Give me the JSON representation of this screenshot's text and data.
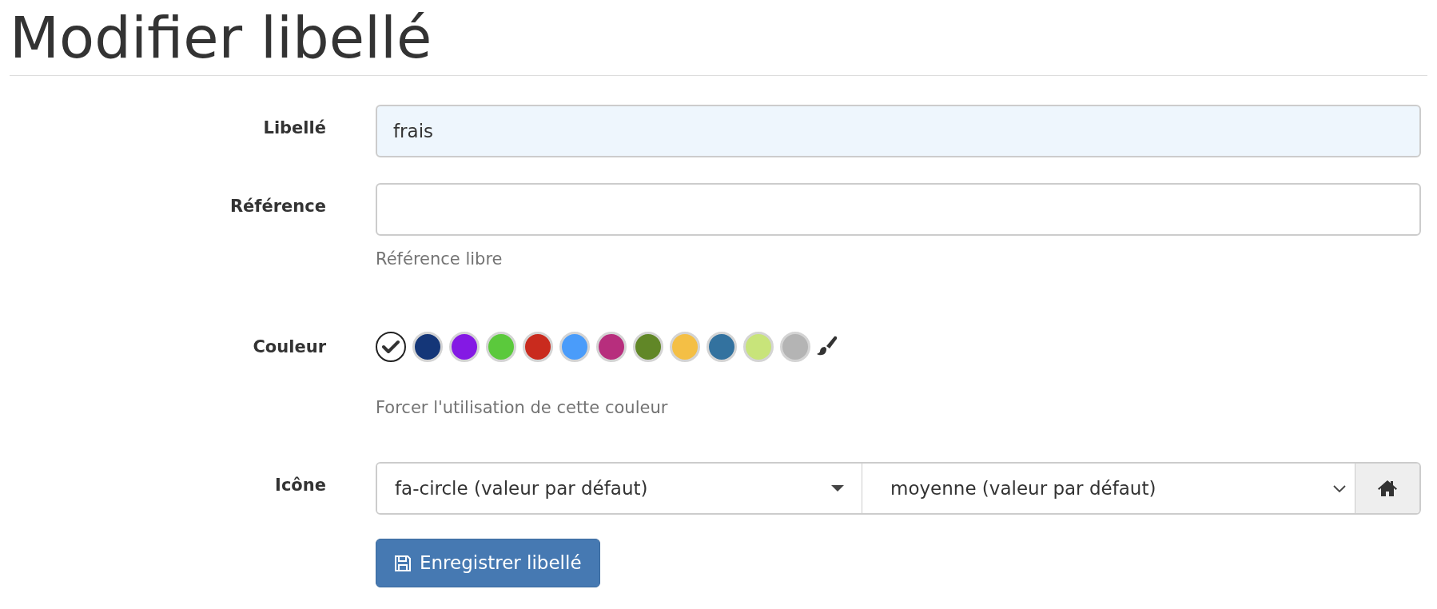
{
  "title": "Modifier libellé",
  "fields": [
    {
      "label": "Libellé",
      "value": "frais",
      "highlighted": true
    },
    {
      "label": "Référence",
      "help": "Référence libre",
      "highlighted": false
    }
  ],
  "color": {
    "label": "Couleur",
    "help": "Forcer l'utilisation de cette couleur",
    "swatches": [
      {
        "kind": "none",
        "selected": true
      },
      {
        "kind": "color",
        "color": "#143678",
        "selected": false
      },
      {
        "kind": "color",
        "color": "#8419e4",
        "selected": false
      },
      {
        "kind": "color",
        "color": "#5bc93c",
        "selected": false
      },
      {
        "kind": "color",
        "color": "#c92b1e",
        "selected": false
      },
      {
        "kind": "color",
        "color": "#4a9cfa",
        "selected": false
      },
      {
        "kind": "color",
        "color": "#b72e7d",
        "selected": false
      },
      {
        "kind": "color",
        "color": "#618727",
        "selected": false
      },
      {
        "kind": "color",
        "color": "#f4bf45",
        "selected": false
      },
      {
        "kind": "color",
        "color": "#33729f",
        "selected": false
      },
      {
        "kind": "color",
        "color": "#c8e47a",
        "selected": false
      },
      {
        "kind": "color",
        "color": "#b4b4b4",
        "selected": false
      }
    ]
  },
  "icon": {
    "label": "Icône",
    "icon_value": "fa-circle (valeur par défaut)",
    "size_value": "moyenne (valeur par défaut)"
  },
  "save_button": "Enregistrer libellé"
}
